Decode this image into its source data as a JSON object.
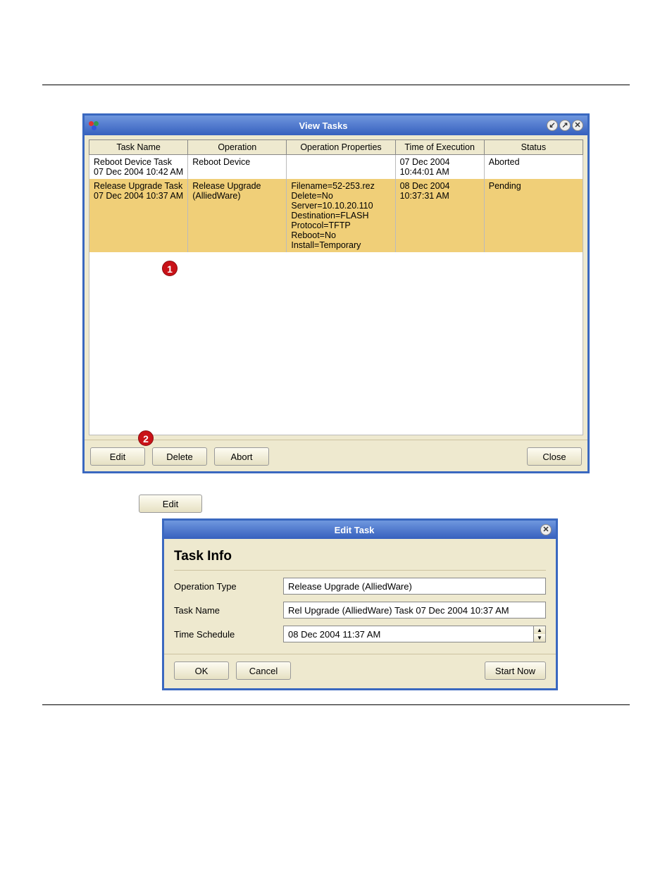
{
  "viewTasks": {
    "title": "View Tasks",
    "columns": [
      "Task Name",
      "Operation",
      "Operation Properties",
      "Time of Execution",
      "Status"
    ],
    "rows": [
      {
        "selected": false,
        "taskName": "Reboot Device Task 07 Dec 2004 10:42 AM",
        "operation": "Reboot Device",
        "props": "",
        "time": "07 Dec 2004 10:44:01 AM",
        "status": "Aborted"
      },
      {
        "selected": true,
        "taskName": "Release Upgrade Task 07 Dec 2004 10:37 AM",
        "operation": "Release Upgrade (AlliedWare)",
        "props": "Filename=52-253.rez\nDelete=No\nServer=10.10.20.110\nDestination=FLASH\nProtocol=TFTP\nReboot=No\nInstall=Temporary",
        "time": "08 Dec 2004 10:37:31 AM",
        "status": "Pending"
      }
    ],
    "buttons": {
      "edit": "Edit",
      "delete": "Delete",
      "abort": "Abort",
      "close": "Close"
    }
  },
  "callouts": {
    "one": "1",
    "two": "2"
  },
  "standaloneEdit": "Edit",
  "editTask": {
    "title": "Edit Task",
    "section": "Task Info",
    "labels": {
      "opType": "Operation Type",
      "taskName": "Task Name",
      "schedule": "Time Schedule"
    },
    "values": {
      "opType": "Release Upgrade (AlliedWare)",
      "taskName": "Rel Upgrade (AlliedWare) Task 07 Dec 2004 10:37 AM",
      "schedule": "08 Dec 2004 11:37 AM"
    },
    "buttons": {
      "ok": "OK",
      "cancel": "Cancel",
      "startNow": "Start Now"
    }
  }
}
